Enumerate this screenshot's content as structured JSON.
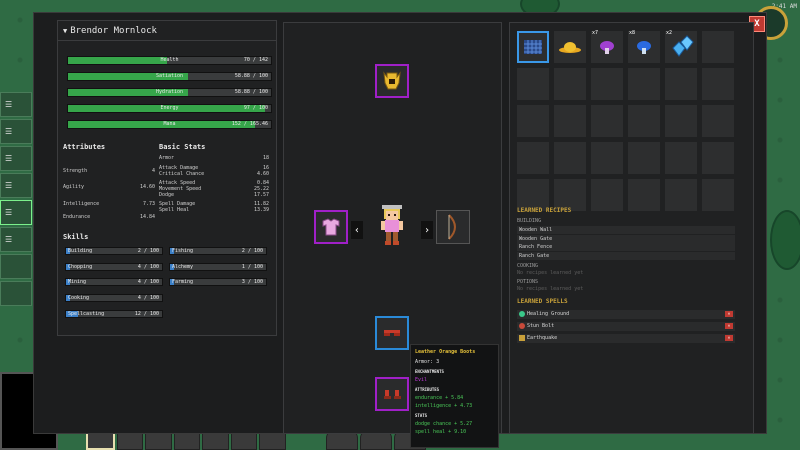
{
  "character": {
    "name": "Brendor Mornlock",
    "bars": [
      {
        "name": "Health",
        "value": "70 / 142",
        "fill": 0.49
      },
      {
        "name": "Satiation",
        "value": "58.88 / 100",
        "fill": 0.59
      },
      {
        "name": "Hydration",
        "value": "58.88 / 100",
        "fill": 0.59
      },
      {
        "name": "Energy",
        "value": "97 / 100",
        "fill": 0.97
      },
      {
        "name": "Mana",
        "value": "152 / 165.46",
        "fill": 0.92
      }
    ],
    "attributes_title": "Attributes",
    "attributes": [
      {
        "label": "Strength",
        "value": "4"
      },
      {
        "label": "Agility",
        "value": "14.60"
      },
      {
        "label": "Intelligence",
        "value": "7.73"
      },
      {
        "label": "Endurance",
        "value": "14.84"
      }
    ],
    "basic_stats_title": "Basic Stats",
    "basic_stats": [
      {
        "label": "Armor",
        "value": "18"
      },
      {
        "label": "Attack Damage",
        "value": "16"
      },
      {
        "label": "Critical Chance",
        "value": "4.60"
      },
      {
        "label": "Attack Speed",
        "value": "0.84"
      },
      {
        "label": "Movement Speed",
        "value": "25.22"
      },
      {
        "label": "Dodge",
        "value": "17.57"
      },
      {
        "label": "Spell Damage",
        "value": "11.82"
      },
      {
        "label": "Spell Heal",
        "value": "13.39"
      }
    ],
    "skills_title": "Skills",
    "skills": [
      {
        "name": "Building",
        "value": "2 / 100",
        "fill": 0.02
      },
      {
        "name": "Fishing",
        "value": "2 / 100",
        "fill": 0.02
      },
      {
        "name": "Chopping",
        "value": "4 / 100",
        "fill": 0.04
      },
      {
        "name": "Alchemy",
        "value": "1 / 100",
        "fill": 0.01
      },
      {
        "name": "Mining",
        "value": "4 / 100",
        "fill": 0.04
      },
      {
        "name": "Farming",
        "value": "3 / 100",
        "fill": 0.03
      },
      {
        "name": "Cooking",
        "value": "4 / 100",
        "fill": 0.04
      },
      {
        "name": "Spellcasting",
        "value": "12 / 100",
        "fill": 0.12
      }
    ]
  },
  "inventory": {
    "quantities": [
      "",
      "",
      "x7",
      "x8",
      "x2"
    ],
    "icons": [
      "mesh-item-icon",
      "straw-hat-icon",
      "purple-mushroom-icon",
      "blue-mushroom-icon",
      "blue-gem-icon"
    ]
  },
  "recipes": {
    "title": "LEARNED RECIPES",
    "building_label": "BUILDING",
    "building": [
      "Wooden Wall",
      "Wooden Gate",
      "Ranch Fence",
      "Ranch Gate"
    ],
    "cooking_label": "COOKING",
    "cooking_empty": "No recipes learned yet",
    "potions_label": "POTIONS",
    "potions_empty": "No recipes learned yet"
  },
  "spells": {
    "title": "LEARNED SPELLS",
    "items": [
      {
        "name": "Healing Ground",
        "color": "#3ac88a"
      },
      {
        "name": "Stun Bolt",
        "color": "#c84a3a"
      },
      {
        "name": "Earthquake",
        "color": "#c8a03a"
      }
    ]
  },
  "tooltip": {
    "title": "Leather Orange Boots",
    "armor": "Armor: 3",
    "enchantments_label": "ENCHANTMENTS",
    "enchantment": "Evil",
    "attributes_label": "ATTRIBUTES",
    "attributes": [
      "endurance + 5.84",
      "intelligence + 4.73"
    ],
    "stats_label": "STATS",
    "stats": [
      "dodge chance + 5.27",
      "spell heal + 9.10"
    ]
  },
  "close_label": "X",
  "arrows": {
    "left": "‹",
    "right": "›"
  },
  "clock": "2:41 AM",
  "colors": {
    "rare": "#a020c8",
    "uncommon": "#2a8ad8",
    "health": "#36a64a",
    "gold": "#c9a23a"
  }
}
